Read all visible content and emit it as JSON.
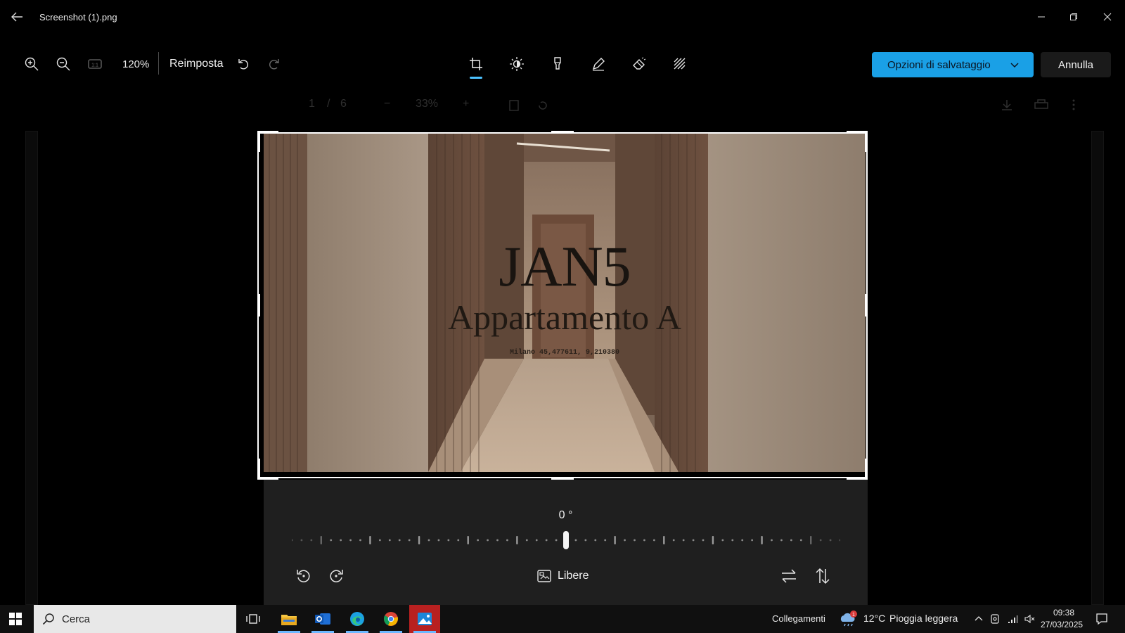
{
  "window": {
    "title": "Screenshot (1).png"
  },
  "toolbar": {
    "zoom_level": "120%",
    "reset_label": "Reimposta",
    "save_options_label": "Opzioni di salvataggio",
    "cancel_label": "Annulla",
    "active_tool": "crop",
    "accent_color": "#4cc2ff",
    "primary_button_color": "#1aa0e6"
  },
  "background_viewer": {
    "page_current": "1",
    "page_separator": "/",
    "page_total": "6",
    "zoom": "33%",
    "minus": "−",
    "plus": "+"
  },
  "photo": {
    "title": "JAN5",
    "subtitle": "Appartamento A",
    "coords": "Milano 45,477611, 9,210380"
  },
  "crop_panel": {
    "angle_label": "0 °",
    "angle_value": 0,
    "aspect_label": "Libere"
  },
  "taskbar": {
    "search_placeholder": "Cerca",
    "links_label": "Collegamenti",
    "temperature": "12°C",
    "weather_desc": "Pioggia leggera",
    "weather_badge": "1",
    "time": "09:38",
    "date": "27/03/2025"
  }
}
